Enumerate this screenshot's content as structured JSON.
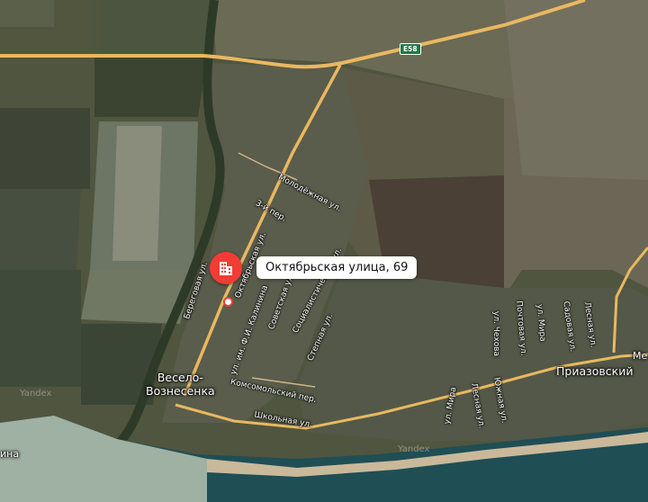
{
  "place": {
    "address": "Октябрьская улица, 69",
    "marker_icon": "building-icon",
    "marker_color": "#f03d35"
  },
  "settlements": {
    "vesyolo": "Весело-\nВознесенка",
    "priazovsky": "Приазовский",
    "left_edge": "ина",
    "right_edge": "Ме"
  },
  "roads": {
    "e58": "E58",
    "molodezhnaya": "Молодёжная ул.",
    "third_per": "3-й пер.",
    "beregovaya": "Береговая ул.",
    "oktyabrskaya": "Октябрьская ул.",
    "kalinina": "ул. им. Ф.И. Калинина",
    "sovetskaya": "Советская ул.",
    "sotsialisticheskaya": "Социалистическая ул.",
    "stepnaya": "Степная ул.",
    "komsomolsky": "Комсомольский пер.",
    "shkolnaya": "Школьная ул.",
    "chekhova": "ул. Чехова",
    "pochtovaya": "Почтовая ул.",
    "mira_top": "ул. Мира",
    "sadovaya": "Садовая ул.",
    "lesnaya_top": "Лесная ул.",
    "mira_bottom": "ул. Мира",
    "lesnaya_bottom": "Лесная ул.",
    "yuzhnaya": "Южная ул."
  },
  "watermarks": {
    "left": "Yandex",
    "bottom": "Yandex"
  }
}
